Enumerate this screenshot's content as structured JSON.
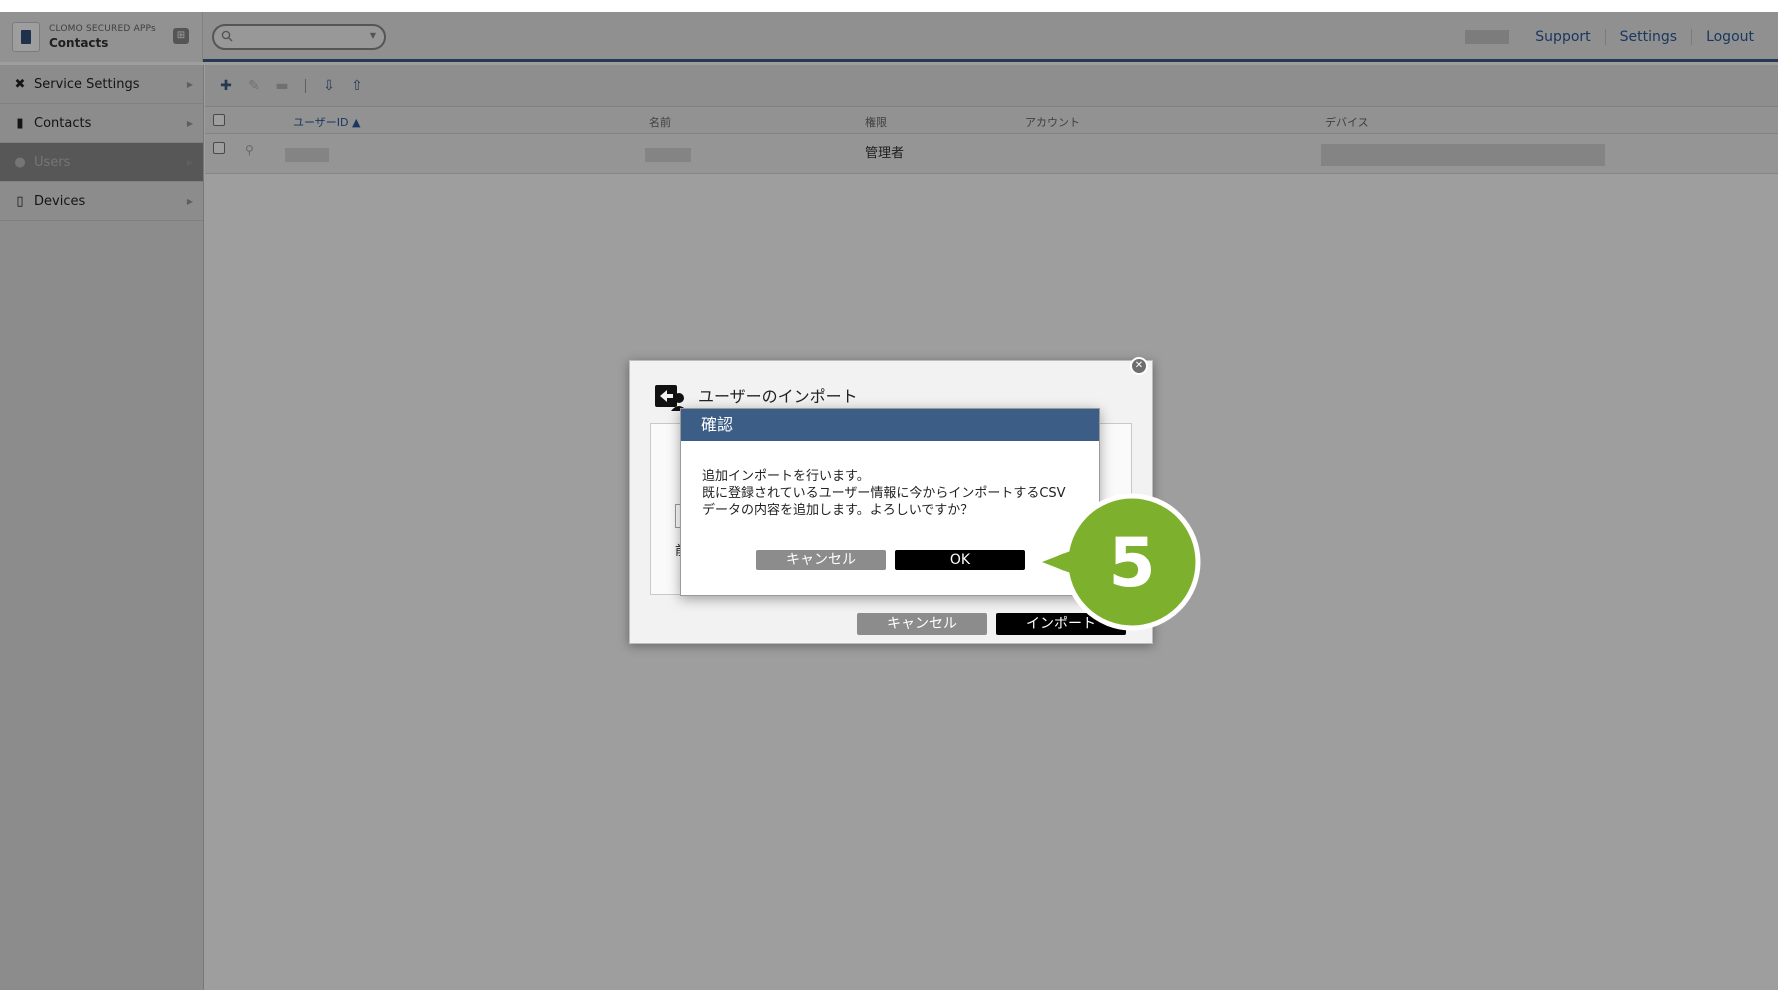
{
  "header": {
    "brand_top": "CLOMO SECURED APPs",
    "brand_name": "Contacts",
    "links": [
      "Support",
      "Settings",
      "Logout"
    ]
  },
  "sidebar": {
    "items": [
      {
        "label": "Service Settings",
        "icon": "tools-icon"
      },
      {
        "label": "Contacts",
        "icon": "book-icon"
      },
      {
        "label": "Users",
        "icon": "user-icon"
      },
      {
        "label": "Devices",
        "icon": "devices-icon"
      }
    ],
    "active": "Users"
  },
  "toolbar": {
    "icons": [
      "add-user-icon",
      "edit-icon",
      "delete-icon",
      "import-icon",
      "export-user-icon"
    ]
  },
  "table": {
    "headers": {
      "user_id": "ユーザーID ▲",
      "name": "名前",
      "role": "権限",
      "account": "アカウント",
      "device": "デバイス"
    },
    "rows": [
      {
        "role": "管理者"
      }
    ]
  },
  "import_dialog": {
    "title": "ユーザーのインポート",
    "cancel": "キャンセル",
    "import": "インポート"
  },
  "confirm_dialog": {
    "title": "確認",
    "message_line1": "追加インポートを行います。",
    "message_line2": "既に登録されているユーザー情報に今からインポートするCSV",
    "message_line3": "データの内容を追加します。よろしいですか？",
    "cancel": "キャンセル",
    "ok": "OK"
  },
  "callout": {
    "step": "5",
    "color": "#7db02c"
  },
  "colors": {
    "accent": "#3c5d86",
    "link": "#2a5a9a"
  }
}
